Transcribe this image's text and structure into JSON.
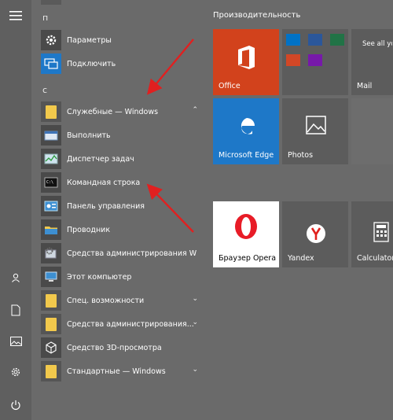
{
  "letters": [
    "п",
    "с"
  ],
  "items": [
    {
      "label": "Параметры",
      "icon": "gear-icon"
    },
    {
      "label": "Подключить",
      "icon": "connect-icon"
    },
    {
      "label": "Служебные — Windows",
      "icon": "folder-icon",
      "expanded": true
    },
    {
      "label": "Выполнить",
      "icon": "run-icon"
    },
    {
      "label": "Диспетчер задач",
      "icon": "task-manager-icon"
    },
    {
      "label": "Командная строка",
      "icon": "command-prompt-icon"
    },
    {
      "label": "Панель управления",
      "icon": "control-panel-icon"
    },
    {
      "label": "Проводник",
      "icon": "explorer-icon"
    },
    {
      "label": "Средства администрирования Wi...",
      "icon": "admin-tools-icon"
    },
    {
      "label": "Этот компьютер",
      "icon": "this-pc-icon"
    },
    {
      "label": "Спец. возможности",
      "icon": "folder-icon"
    },
    {
      "label": "Средства администрирования...",
      "icon": "folder-icon"
    },
    {
      "label": "Средство 3D-просмотра",
      "icon": "3d-viewer-icon"
    },
    {
      "label": "Стандартные — Windows",
      "icon": "folder-icon"
    }
  ],
  "tiles_group_title": "Производительность",
  "tiles": {
    "office": "Office",
    "mail_text": "See all your mail in one place",
    "mail": "Mail",
    "edge": "Microsoft Edge",
    "photos": "Photos",
    "opera": "Браузер Opera",
    "yandex": "Yandex",
    "calculator": "Calculator"
  },
  "colors": {
    "accent_tile": "#1e78c8",
    "office_tile": "#d2421c",
    "arrow": "#e02020",
    "background": "#6a6a6a"
  }
}
